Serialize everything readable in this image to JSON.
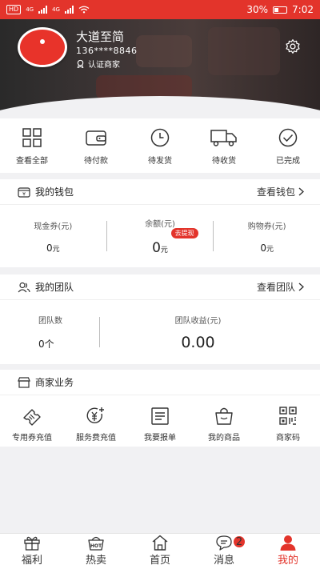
{
  "status_bar": {
    "network_label": "HD",
    "signal_1": "4G",
    "signal_2": "4G",
    "battery": "30%",
    "time": "7:02"
  },
  "profile": {
    "name": "大道至简",
    "phone": "136****8846",
    "verified_label": "认证商家",
    "settings_icon": "gear-icon"
  },
  "orders": [
    {
      "label": "查看全部",
      "icon": "grid-icon"
    },
    {
      "label": "待付款",
      "icon": "wallet-icon"
    },
    {
      "label": "待发货",
      "icon": "clock-icon"
    },
    {
      "label": "待收货",
      "icon": "truck-icon"
    },
    {
      "label": "已完成",
      "icon": "check-circle-icon"
    }
  ],
  "wallet": {
    "title": "我的钱包",
    "more": "查看钱包",
    "columns": [
      {
        "label": "现金券(元)",
        "value": "0",
        "unit": "元"
      },
      {
        "label": "余额(元)",
        "value": "0",
        "unit": "元",
        "badge": "去提现"
      },
      {
        "label": "购物券(元)",
        "value": "0",
        "unit": "元"
      }
    ]
  },
  "team": {
    "title": "我的团队",
    "more": "查看团队",
    "count_label": "团队数",
    "count_value": "0个",
    "income_label": "团队收益(元)",
    "income_value": "0.00"
  },
  "business": {
    "title": "商家业务",
    "items": [
      {
        "label": "专用券充值",
        "icon": "ticket-icon"
      },
      {
        "label": "服务费充值",
        "icon": "yuan-plus-icon"
      },
      {
        "label": "我要报单",
        "icon": "form-icon"
      },
      {
        "label": "我的商品",
        "icon": "bag-icon"
      },
      {
        "label": "商家码",
        "icon": "qrcode-icon"
      }
    ]
  },
  "tabs": [
    {
      "label": "福利",
      "icon": "gift-icon"
    },
    {
      "label": "热卖",
      "icon": "hot-basket-icon",
      "icon_text": "HOT"
    },
    {
      "label": "首页",
      "icon": "home-icon"
    },
    {
      "label": "消息",
      "icon": "chat-icon",
      "badge": "2"
    },
    {
      "label": "我的",
      "icon": "person-icon",
      "active": true
    }
  ],
  "colors": {
    "accent": "#e3342b",
    "background": "#f1f1f3"
  }
}
